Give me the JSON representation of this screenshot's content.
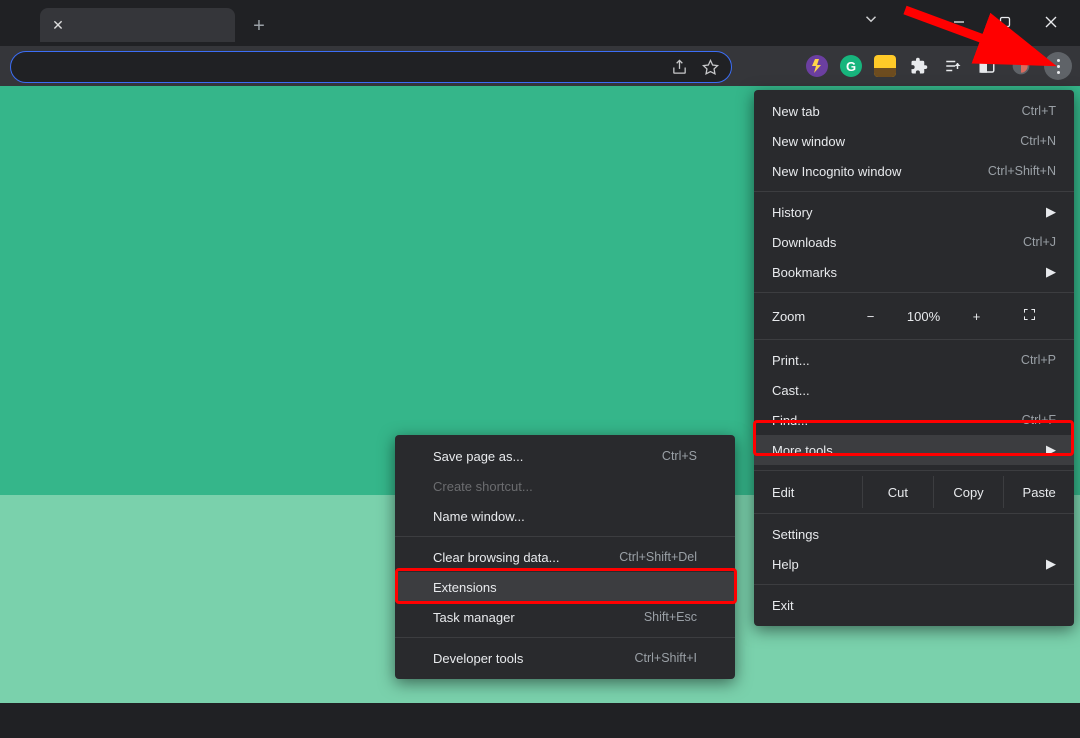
{
  "menu": {
    "new_tab": {
      "label": "New tab",
      "shortcut": "Ctrl+T"
    },
    "new_window": {
      "label": "New window",
      "shortcut": "Ctrl+N"
    },
    "new_incognito": {
      "label": "New Incognito window",
      "shortcut": "Ctrl+Shift+N"
    },
    "history": {
      "label": "History"
    },
    "downloads": {
      "label": "Downloads",
      "shortcut": "Ctrl+J"
    },
    "bookmarks": {
      "label": "Bookmarks"
    },
    "zoom": {
      "label": "Zoom",
      "minus": "−",
      "value": "100%",
      "plus": "+"
    },
    "print": {
      "label": "Print...",
      "shortcut": "Ctrl+P"
    },
    "cast": {
      "label": "Cast..."
    },
    "find": {
      "label": "Find...",
      "shortcut": "Ctrl+F"
    },
    "more_tools": {
      "label": "More tools"
    },
    "edit": {
      "label": "Edit",
      "cut": "Cut",
      "copy": "Copy",
      "paste": "Paste"
    },
    "settings": {
      "label": "Settings"
    },
    "help": {
      "label": "Help"
    },
    "exit": {
      "label": "Exit"
    }
  },
  "submenu": {
    "save_page": {
      "label": "Save page as...",
      "shortcut": "Ctrl+S"
    },
    "create_shortcut": {
      "label": "Create shortcut..."
    },
    "name_window": {
      "label": "Name window..."
    },
    "clear_browsing": {
      "label": "Clear browsing data...",
      "shortcut": "Ctrl+Shift+Del"
    },
    "extensions": {
      "label": "Extensions"
    },
    "task_manager": {
      "label": "Task manager",
      "shortcut": "Shift+Esc"
    },
    "developer_tools": {
      "label": "Developer tools",
      "shortcut": "Ctrl+Shift+I"
    }
  }
}
